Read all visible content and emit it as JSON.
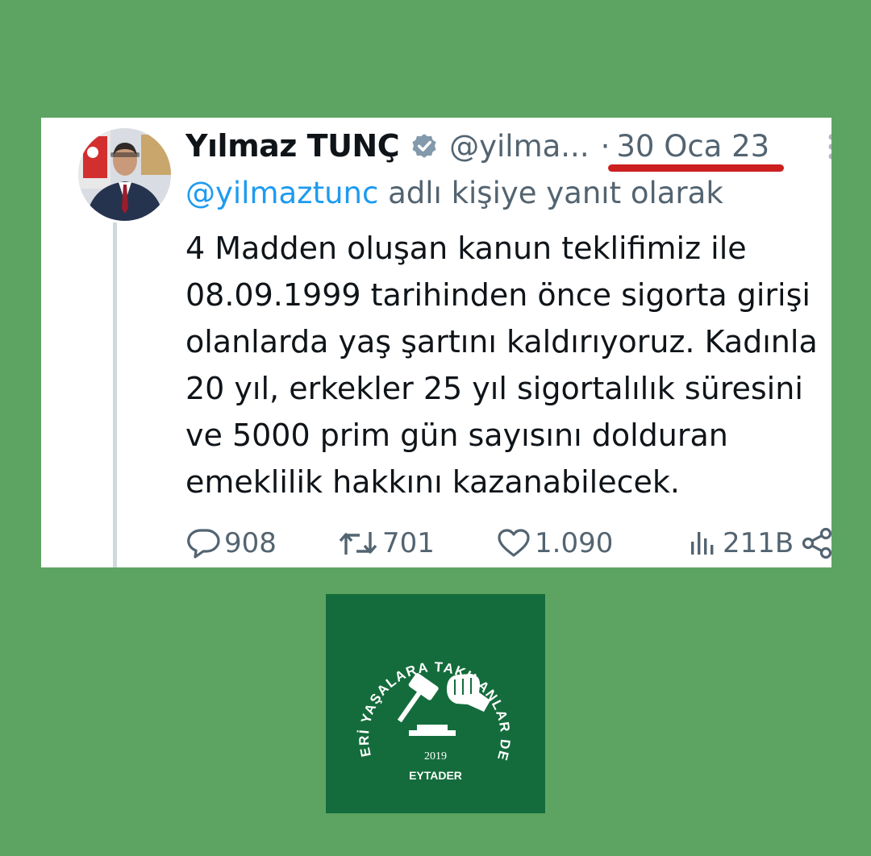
{
  "tweet": {
    "author_name": "Yılmaz TUNÇ",
    "handle": "@yilma...",
    "date_separator": "·",
    "date": "30 Oca 23",
    "reply_to_mention": "@yilmaztunc",
    "reply_to_text": " adlı kişiye yanıt olarak",
    "body_lines": [
      "4 Madden oluşan kanun teklifimiz ile",
      "08.09.1999 tarihinden önce sigorta girişi",
      "olanlarda yaş şartını kaldırıyoruz. Kadınla",
      "20 yıl, erkekler 25 yıl sigortalılık süresini",
      "ve 5000 prim gün sayısını dolduran",
      "emeklilik hakkını kazanabilecek."
    ],
    "actions": {
      "replies": "908",
      "retweets": "701",
      "likes": "1.090",
      "views": "211B"
    }
  },
  "logo": {
    "arc_text": "EMEKLERİ YAŞALARA TAKILANLAR DERNEĞİ",
    "year": "2019",
    "abbr": "EYTADER"
  },
  "colors": {
    "page_background": "#5da462",
    "logo_background": "#146c3c",
    "underline": "#cc1f1f",
    "mention": "#1d9bf0",
    "muted_text": "#536471"
  }
}
